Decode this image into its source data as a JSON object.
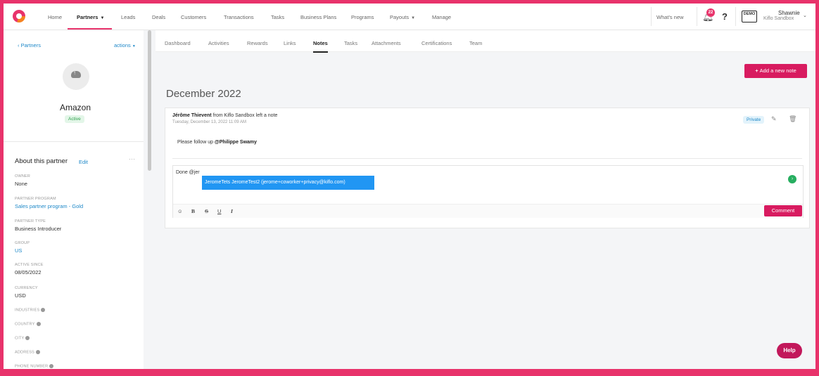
{
  "nav": {
    "items": [
      "Home",
      "Partners",
      "Leads",
      "Deals",
      "Customers",
      "Transactions",
      "Tasks",
      "Business Plans",
      "Programs",
      "Payouts",
      "Manage"
    ],
    "whats_new": "What's new",
    "notification_count": "22",
    "help_mark": "?",
    "demo_label": "DEMO",
    "user_name": "Shawnie",
    "user_org": "Kiflo Sandbox"
  },
  "sidebar": {
    "back_label": "Partners",
    "actions_label": "actions",
    "company_name": "Amazon",
    "status": "Active",
    "about_title": "About this partner",
    "edit_label": "Edit",
    "fields": [
      {
        "label": "OWNER",
        "value": "None",
        "link": false
      },
      {
        "label": "PARTNER PROGRAM",
        "value": "Sales partner program - Gold",
        "link": true
      },
      {
        "label": "PARTNER TYPE",
        "value": "Business Introducer",
        "link": false
      },
      {
        "label": "GROUP",
        "value": "US",
        "link": true
      },
      {
        "label": "ACTIVE SINCE",
        "value": "08/05/2022",
        "link": false
      },
      {
        "label": "CURRENCY",
        "value": "USD",
        "link": false
      }
    ],
    "info_fields": [
      "INDUSTRIES",
      "COUNTRY",
      "CITY",
      "ADDRESS",
      "PHONE NUMBER"
    ]
  },
  "tabs": [
    "Dashboard",
    "Activities",
    "Rewards",
    "Links",
    "Notes",
    "Tasks",
    "Attachments",
    "Certifications",
    "Team"
  ],
  "main": {
    "add_note_label": "Add a new note",
    "month_title": "December 2022",
    "note": {
      "author": "Jérôme Thievent",
      "middle": " from Kiflo Sandbox left a note",
      "date": "Tuesday, December 13, 2022 11:09 AM",
      "privacy": "Private",
      "body_prefix": "Please follow up ",
      "body_mention": "@Philippe Swamy"
    },
    "comment_value": "Done @jer",
    "mention_suggestion": "JeromeTets JeromeTest2 (jerome+coworker+privacy@kiflo.com)",
    "comment_button": "Comment",
    "help_label": "Help"
  }
}
